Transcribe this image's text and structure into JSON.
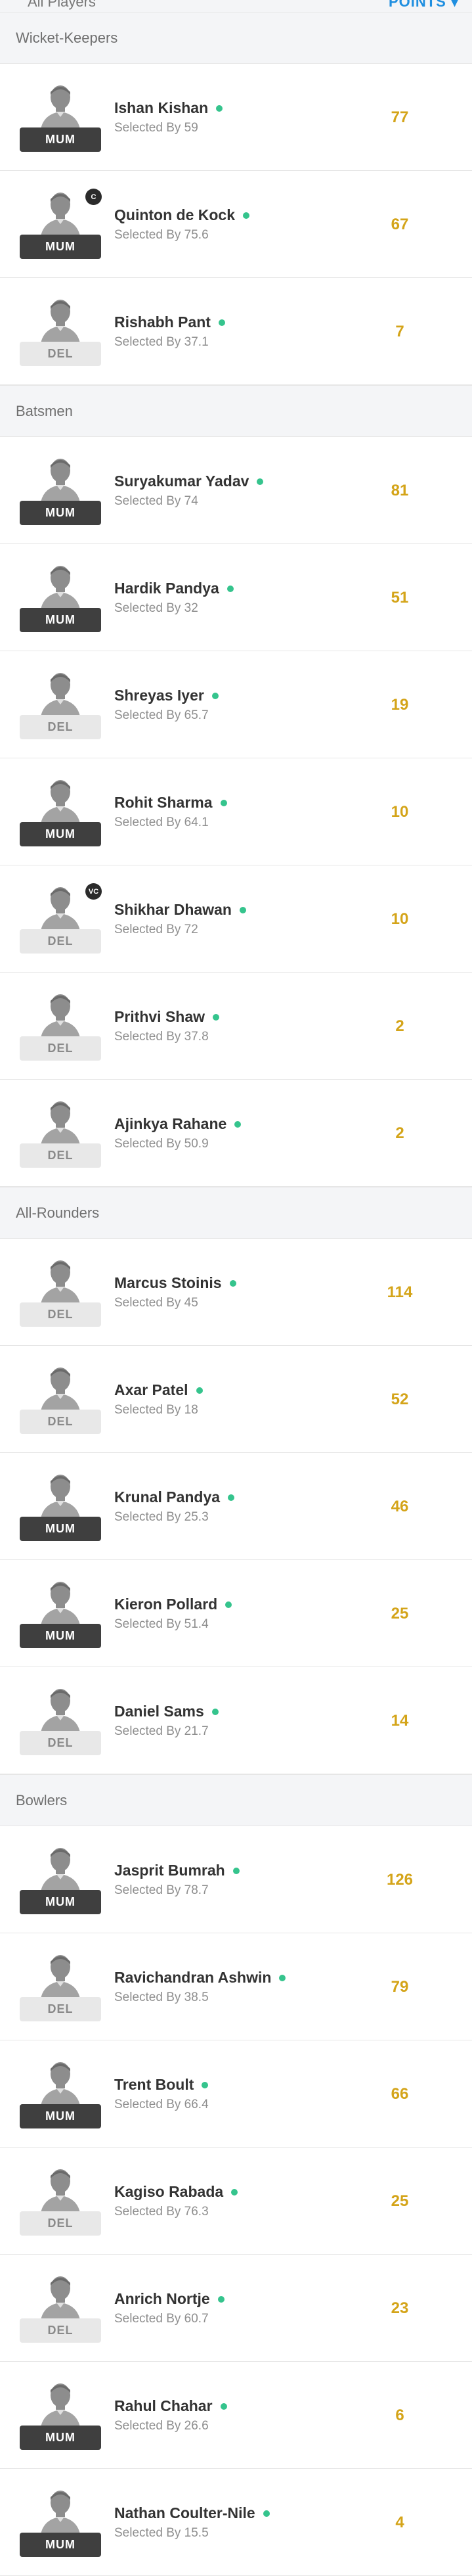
{
  "topbar": {
    "left_label": "All Players",
    "right_label": "POINTS ▾"
  },
  "sections": [
    {
      "title": "Wicket-Keepers",
      "players": [
        {
          "name": "Ishan Kishan",
          "selected": "Selected By 59",
          "points": "77",
          "team": "MUM",
          "badge": ""
        },
        {
          "name": "Quinton de Kock",
          "selected": "Selected By 75.6",
          "points": "67",
          "team": "MUM",
          "badge": "C"
        },
        {
          "name": "Rishabh Pant",
          "selected": "Selected By 37.1",
          "points": "7",
          "team": "DEL",
          "badge": ""
        }
      ]
    },
    {
      "title": "Batsmen",
      "players": [
        {
          "name": "Suryakumar Yadav",
          "selected": "Selected By 74",
          "points": "81",
          "team": "MUM",
          "badge": ""
        },
        {
          "name": "Hardik Pandya",
          "selected": "Selected By 32",
          "points": "51",
          "team": "MUM",
          "badge": ""
        },
        {
          "name": "Shreyas Iyer",
          "selected": "Selected By 65.7",
          "points": "19",
          "team": "DEL",
          "badge": ""
        },
        {
          "name": "Rohit Sharma",
          "selected": "Selected By 64.1",
          "points": "10",
          "team": "MUM",
          "badge": ""
        },
        {
          "name": "Shikhar Dhawan",
          "selected": "Selected By 72",
          "points": "10",
          "team": "DEL",
          "badge": "VC"
        },
        {
          "name": "Prithvi Shaw",
          "selected": "Selected By 37.8",
          "points": "2",
          "team": "DEL",
          "badge": ""
        },
        {
          "name": "Ajinkya Rahane",
          "selected": "Selected By 50.9",
          "points": "2",
          "team": "DEL",
          "badge": ""
        }
      ]
    },
    {
      "title": "All-Rounders",
      "players": [
        {
          "name": "Marcus Stoinis",
          "selected": "Selected By 45",
          "points": "114",
          "team": "DEL",
          "badge": ""
        },
        {
          "name": "Axar Patel",
          "selected": "Selected By 18",
          "points": "52",
          "team": "DEL",
          "badge": ""
        },
        {
          "name": "Krunal Pandya",
          "selected": "Selected By 25.3",
          "points": "46",
          "team": "MUM",
          "badge": ""
        },
        {
          "name": "Kieron Pollard",
          "selected": "Selected By 51.4",
          "points": "25",
          "team": "MUM",
          "badge": ""
        },
        {
          "name": "Daniel Sams",
          "selected": "Selected By 21.7",
          "points": "14",
          "team": "DEL",
          "badge": ""
        }
      ]
    },
    {
      "title": "Bowlers",
      "players": [
        {
          "name": "Jasprit Bumrah",
          "selected": "Selected By 78.7",
          "points": "126",
          "team": "MUM",
          "badge": ""
        },
        {
          "name": "Ravichandran Ashwin",
          "selected": "Selected By 38.5",
          "points": "79",
          "team": "DEL",
          "badge": ""
        },
        {
          "name": "Trent Boult",
          "selected": "Selected By 66.4",
          "points": "66",
          "team": "MUM",
          "badge": ""
        },
        {
          "name": "Kagiso Rabada",
          "selected": "Selected By 76.3",
          "points": "25",
          "team": "DEL",
          "badge": ""
        },
        {
          "name": "Anrich Nortje",
          "selected": "Selected By 60.7",
          "points": "23",
          "team": "DEL",
          "badge": ""
        },
        {
          "name": "Rahul Chahar",
          "selected": "Selected By 26.6",
          "points": "6",
          "team": "MUM",
          "badge": ""
        },
        {
          "name": "Nathan Coulter-Nile",
          "selected": "Selected By 15.5",
          "points": "4",
          "team": "MUM",
          "badge": ""
        }
      ]
    }
  ],
  "colors": {
    "points": "#d4a419",
    "status_dot": "#35c48d",
    "mum_badge": "#3f3f3f",
    "del_badge": "#e8e8e8",
    "sort_link": "#1f8fe0"
  },
  "icons": {
    "avatar": "player-silhouette-icon",
    "status": "playing-status-dot-icon"
  }
}
